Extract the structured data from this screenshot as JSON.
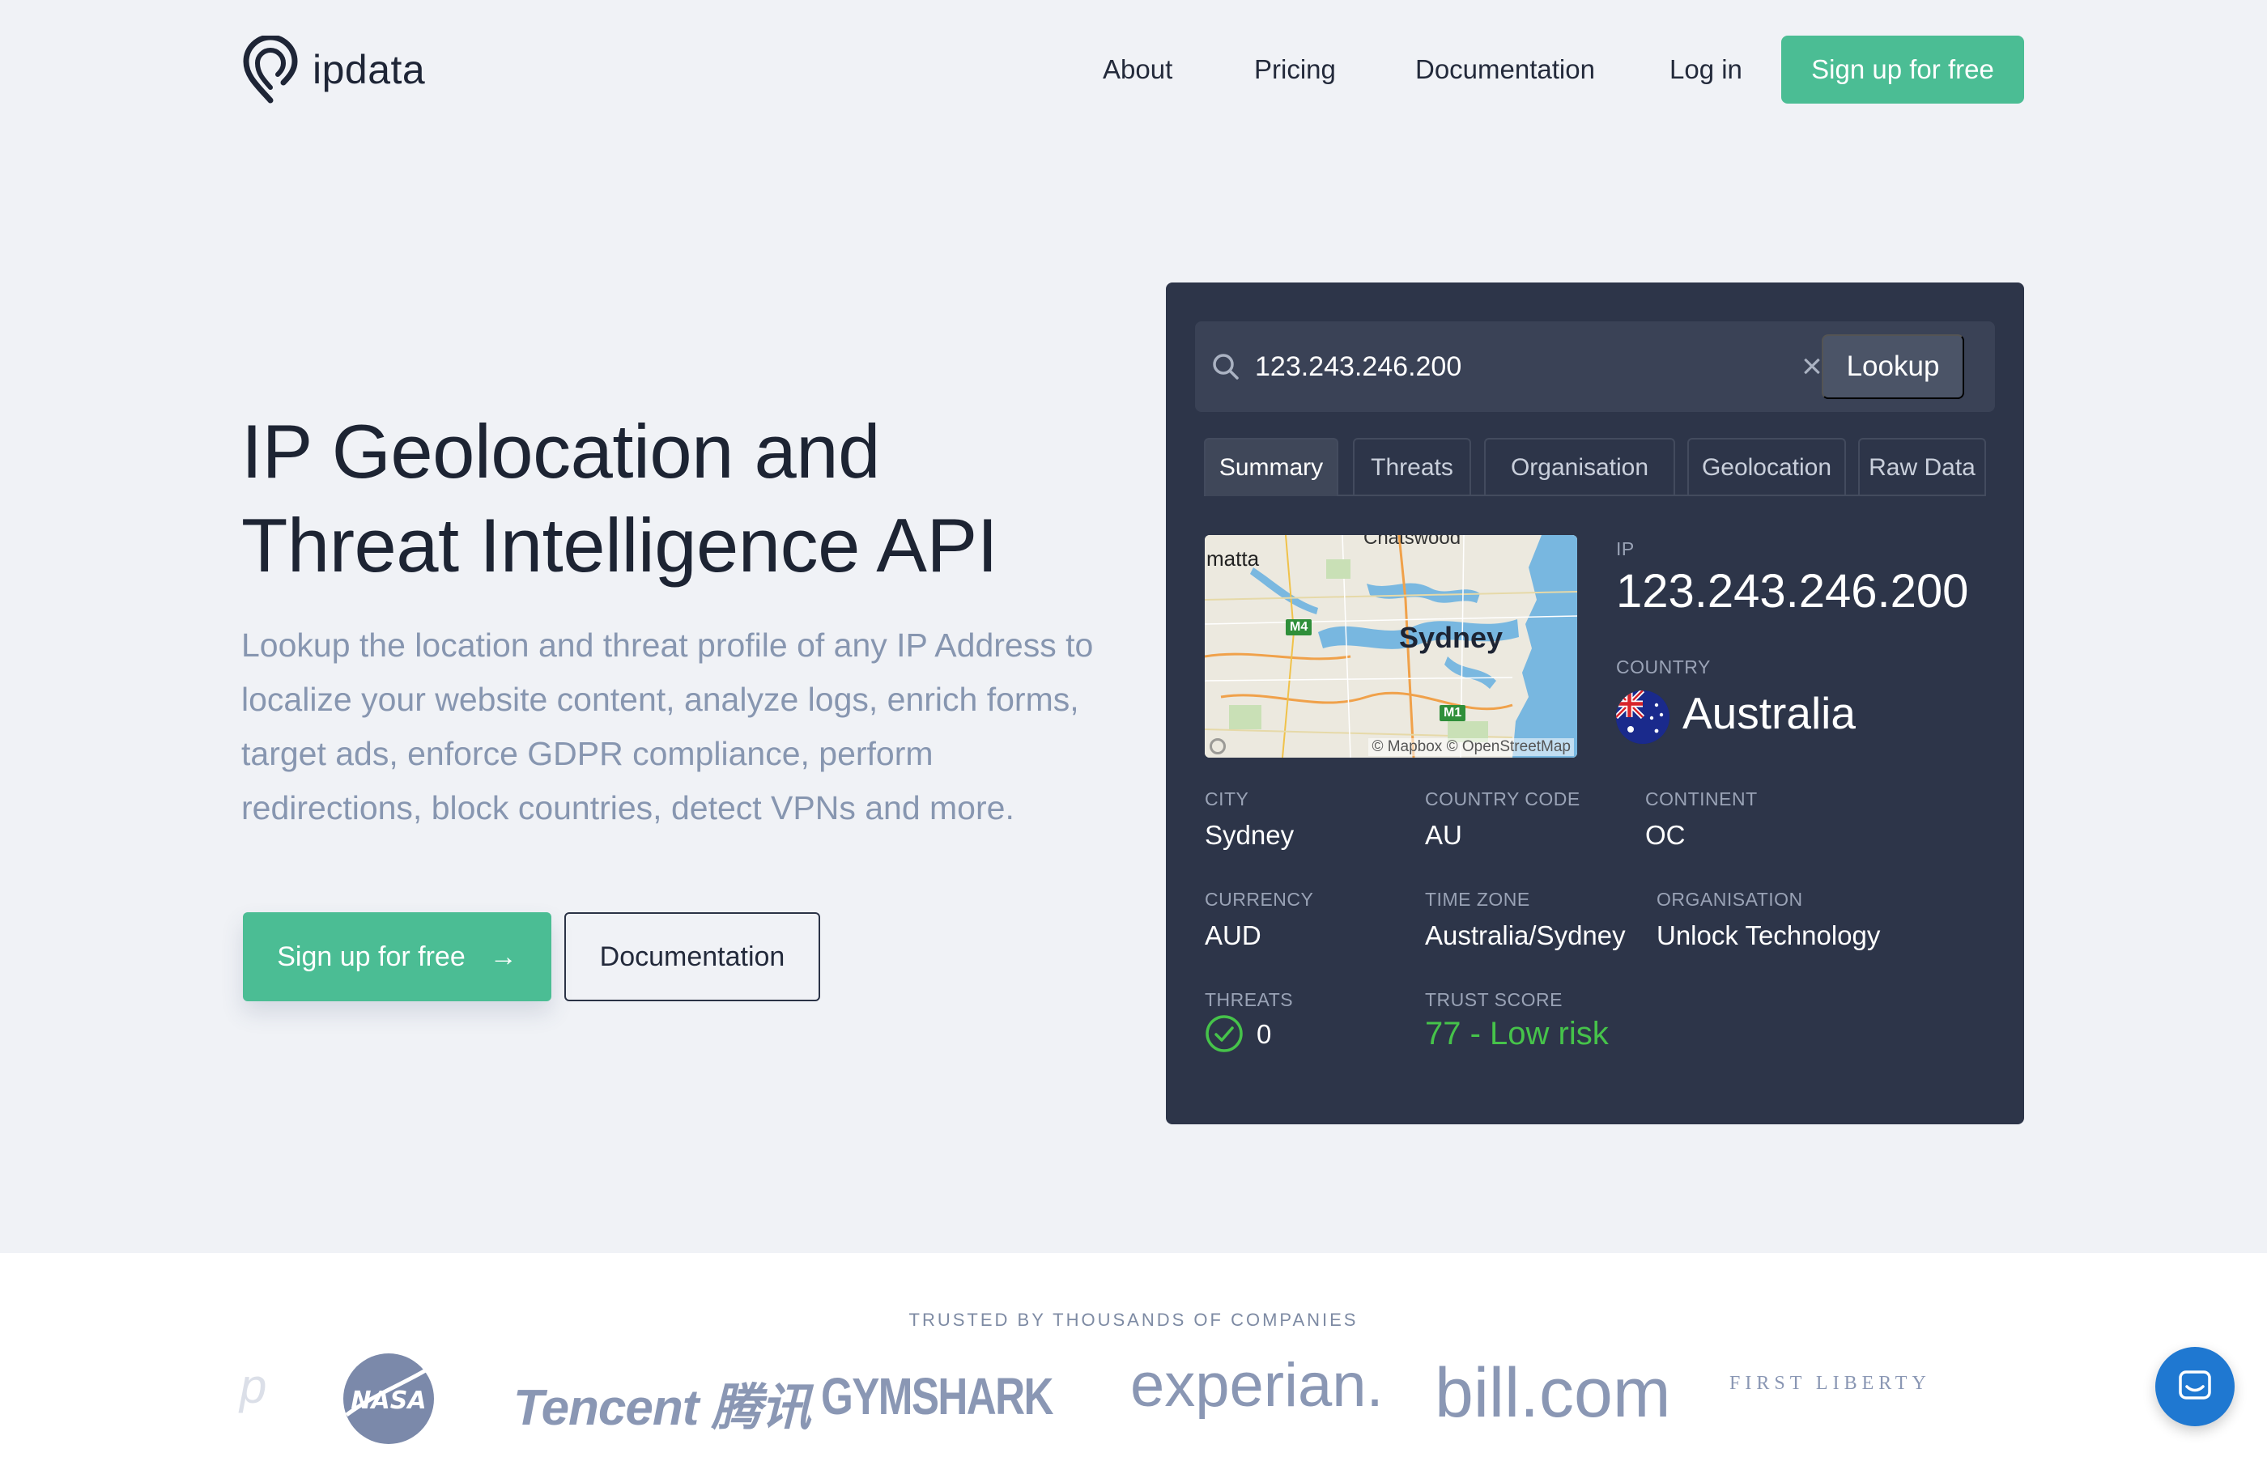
{
  "header": {
    "logo_text": "ipdata",
    "nav": {
      "about": "About",
      "pricing": "Pricing",
      "documentation": "Documentation",
      "login": "Log in",
      "signup": "Sign up for free"
    }
  },
  "hero": {
    "title_line1": "IP Geolocation and",
    "title_line2": "Threat Intelligence API",
    "subtitle": "Lookup the location and threat profile of any IP Address to localize your website content, analyze logs, enrich forms, target ads, enforce GDPR compliance, perform redirections, block countries, detect VPNs and more.",
    "signup_label": "Sign up for free",
    "signup_arrow": "→",
    "docs_label": "Documentation"
  },
  "lookup": {
    "query": "123.243.246.200",
    "clear": "×",
    "button": "Lookup",
    "tabs": [
      "Summary",
      "Threats",
      "Organisation",
      "Geolocation",
      "Raw Data"
    ],
    "active_tab": "Summary",
    "map": {
      "city_label": "Sydney",
      "west_label": "matta",
      "north_label": "Chatswood",
      "m4": "M4",
      "m1": "M1",
      "credit": "© Mapbox © OpenStreetMap"
    },
    "ip_label": "IP",
    "ip_value": "123.243.246.200",
    "country_label": "COUNTRY",
    "country_value": "Australia",
    "fields": {
      "city_label": "CITY",
      "city": "Sydney",
      "country_code_label": "COUNTRY CODE",
      "country_code": "AU",
      "continent_label": "CONTINENT",
      "continent": "OC",
      "currency_label": "CURRENCY",
      "currency": "AUD",
      "timezone_label": "TIME ZONE",
      "timezone": "Australia/Sydney",
      "organisation_label": "ORGANISATION",
      "organisation": "Unlock Technology",
      "threats_label": "THREATS",
      "threats": "0",
      "trust_label": "TRUST SCORE",
      "trust": "77 - Low risk"
    },
    "colors": {
      "trust": "#46c34a",
      "panel": "#2d3549",
      "accent": "#4bbd94"
    }
  },
  "trusted": {
    "heading": "TRUSTED BY THOUSANDS OF COMPANIES",
    "logos": {
      "partial": "p",
      "nasa": "NASA",
      "tencent": "Tencent 腾讯",
      "gymshark": "GYMSHARK",
      "experian": "experian.",
      "bill": "bill.com",
      "first_liberty": "FIRST LIBERTY"
    }
  },
  "icons": {
    "logo": "pin-logo-icon",
    "search": "search-icon",
    "clear": "close-icon",
    "threat_ok": "check-circle-icon",
    "chat": "chat-icon"
  }
}
